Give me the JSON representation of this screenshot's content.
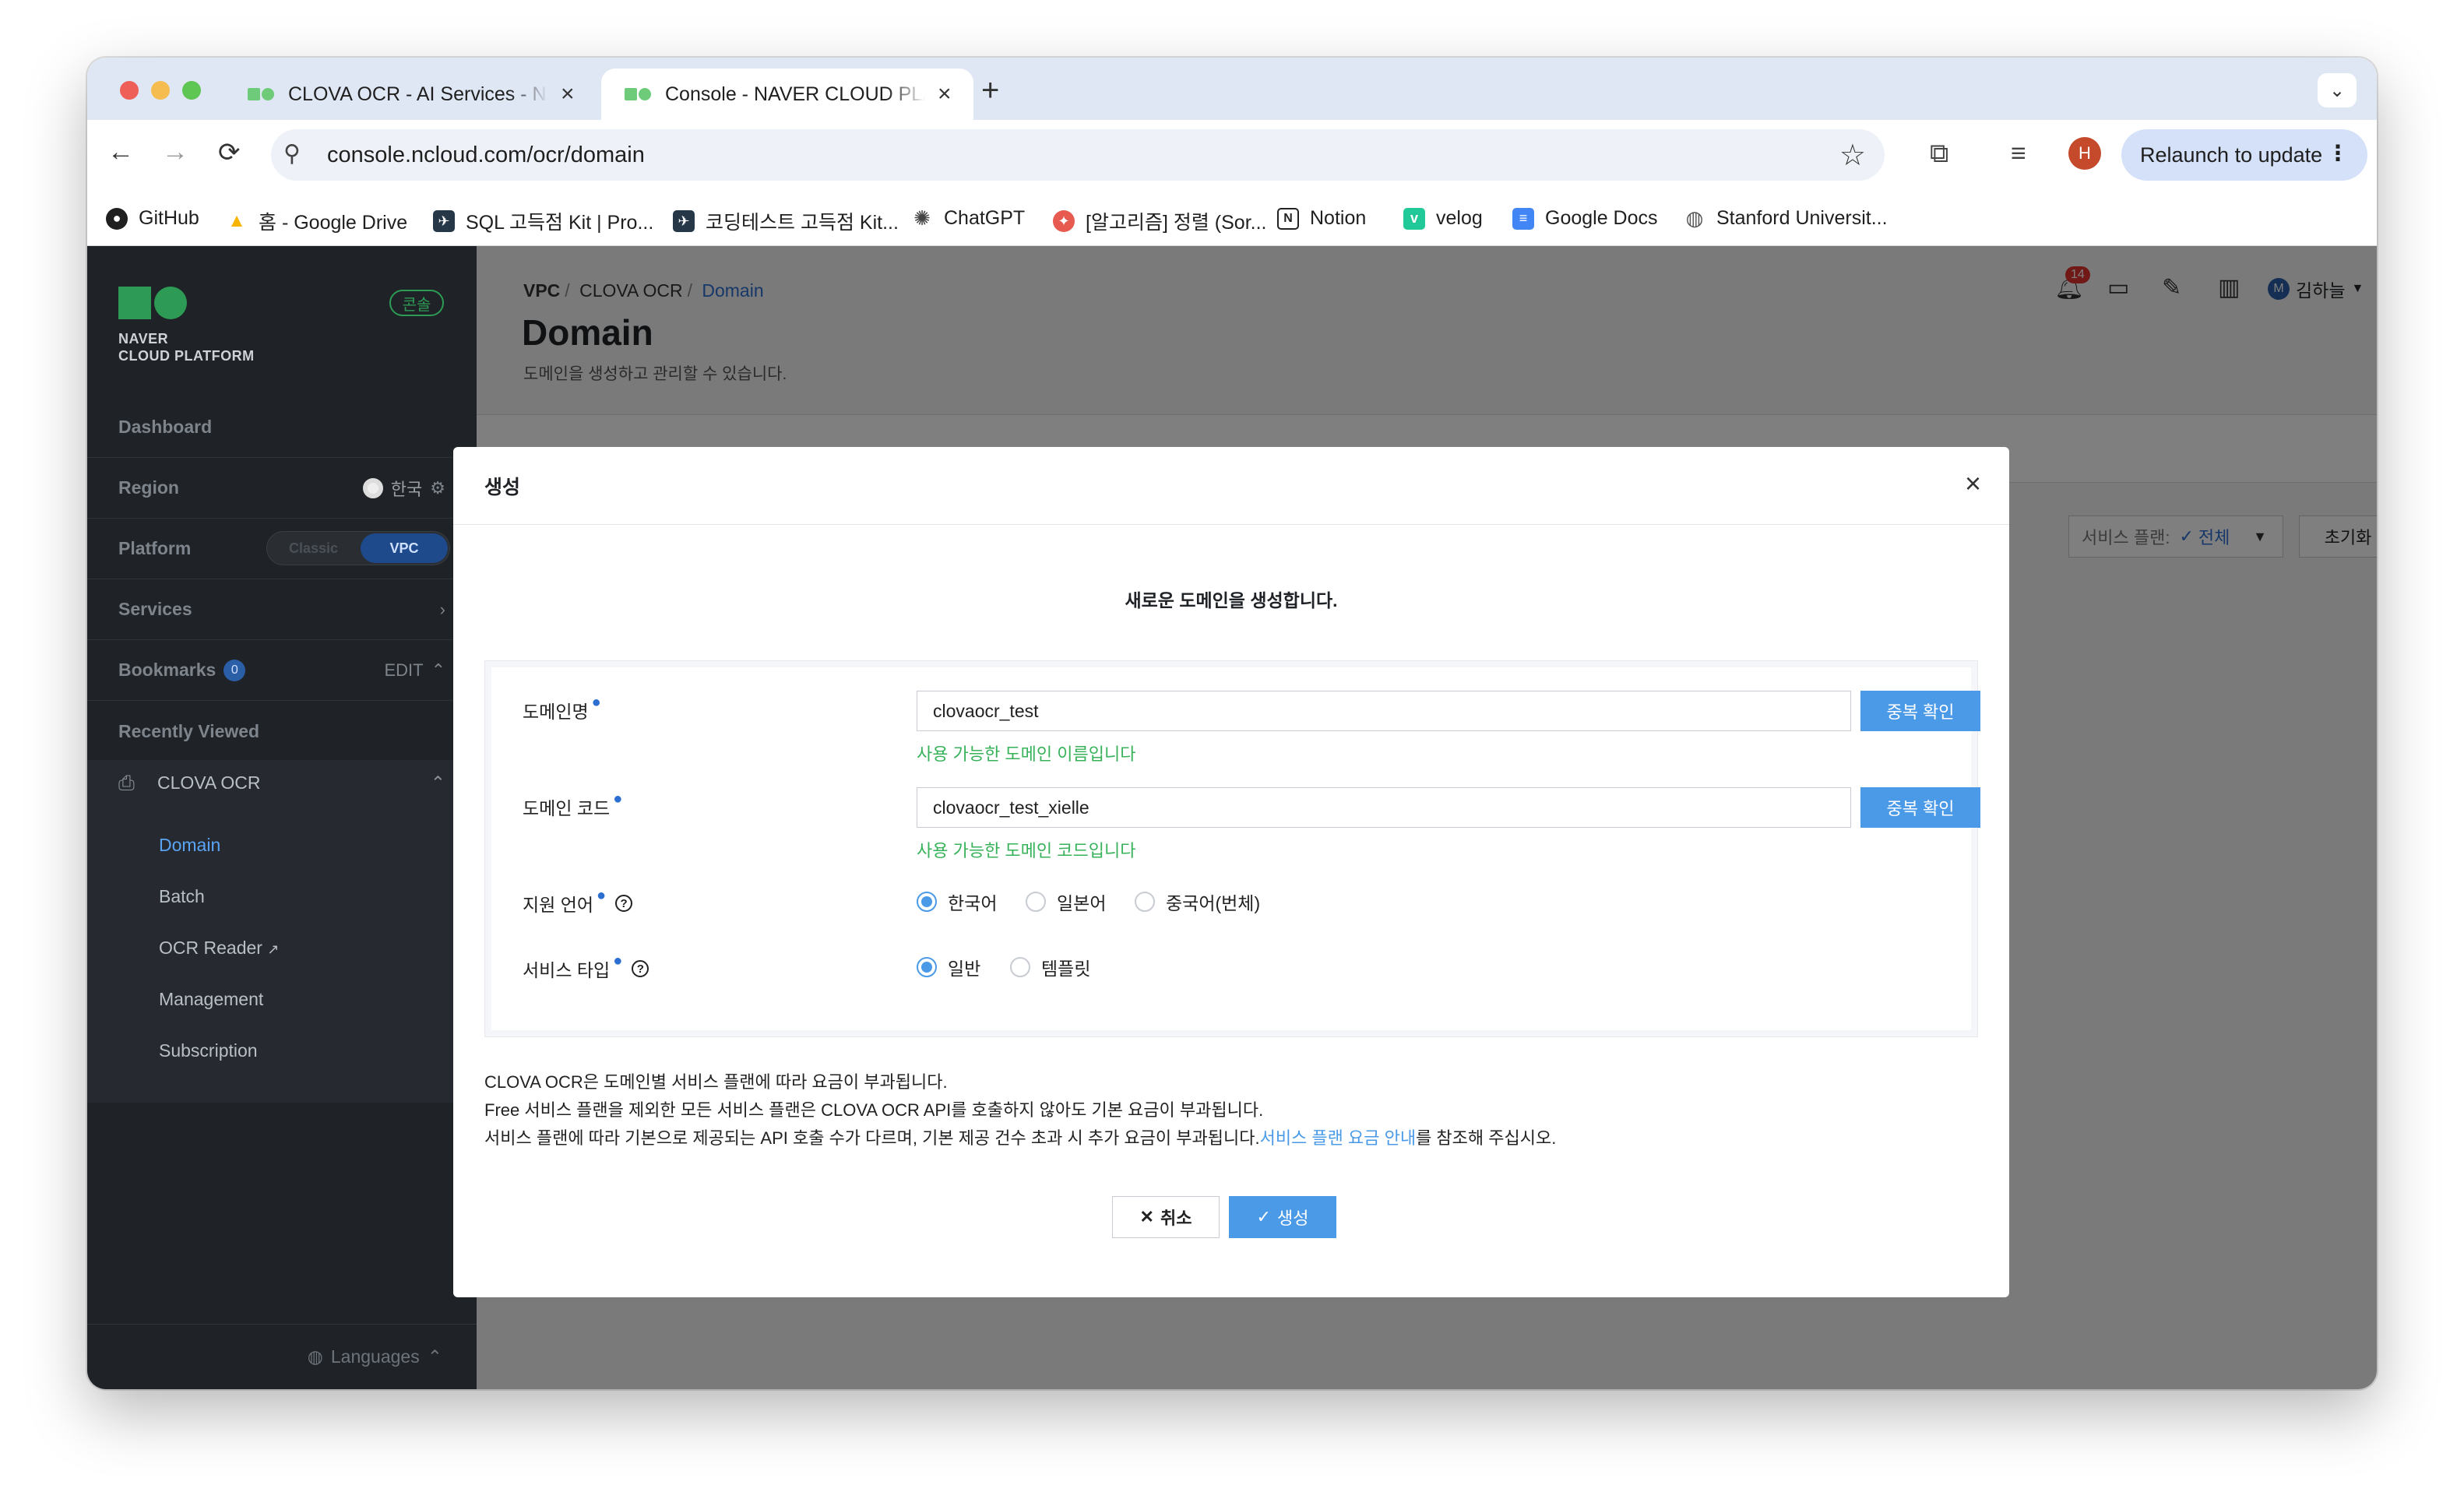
{
  "browser": {
    "tabs": [
      {
        "title": "CLOVA OCR - AI Services - N",
        "active": false
      },
      {
        "title": "Console - NAVER CLOUD PLA",
        "active": true
      }
    ],
    "url": "console.ncloud.com/ocr/domain",
    "profile_initial": "H",
    "relaunch_label": "Relaunch to update",
    "icons": {
      "back": "←",
      "forward": "→",
      "reload": "⟳",
      "star": "☆",
      "extensions": "⧉",
      "media": "≡",
      "tune": "⚲"
    }
  },
  "bookmarks": [
    {
      "label": "GitHub",
      "icon": "github-icon",
      "color": "#1f1f1f",
      "glyph": "●"
    },
    {
      "label": "홈 - Google Drive",
      "icon": "google-drive-icon",
      "color": "#f4b400",
      "glyph": "▲"
    },
    {
      "label": "SQL 고득점 Kit | Pro...",
      "icon": "programmers-icon",
      "color": "#263747",
      "glyph": "✈"
    },
    {
      "label": "코딩테스트 고득점 Kit...",
      "icon": "programmers-icon",
      "color": "#263747",
      "glyph": "✈"
    },
    {
      "label": "ChatGPT",
      "icon": "chatgpt-icon",
      "color": "#444444",
      "glyph": "✺"
    },
    {
      "label": "[알고리즘] 정렬 (Sor...",
      "icon": "blog-icon",
      "color": "#e65a4f",
      "glyph": "✦"
    },
    {
      "label": "Notion",
      "icon": "notion-icon",
      "color": "#222222",
      "glyph": "N"
    },
    {
      "label": "velog",
      "icon": "velog-icon",
      "color": "#20c997",
      "glyph": "v"
    },
    {
      "label": "Google Docs",
      "icon": "google-docs-icon",
      "color": "#4285f4",
      "glyph": "≡"
    },
    {
      "label": "Stanford Universit...",
      "icon": "globe-icon",
      "color": "#555555",
      "glyph": "◍"
    }
  ],
  "sidebar": {
    "logo_line1": "NAVER",
    "logo_line2": "CLOUD PLATFORM",
    "console_badge": "콘솔",
    "dashboard": "Dashboard",
    "region_label": "Region",
    "region_value": "한국",
    "platform_label": "Platform",
    "platform_classic": "Classic",
    "platform_vpc": "VPC",
    "services": "Services",
    "bookmarks_label": "Bookmarks",
    "bookmarks_count": "0",
    "bookmarks_edit": "EDIT",
    "recently_viewed": "Recently Viewed",
    "product": "CLOVA OCR",
    "sub_items": [
      "Domain",
      "Batch",
      "OCR Reader",
      "Management",
      "Subscription"
    ],
    "active_sub": "Domain",
    "languages": "Languages"
  },
  "content": {
    "breadcrumb": [
      "VPC",
      "CLOVA OCR",
      "Domain"
    ],
    "title": "Domain",
    "description": "도메인을 생성하고 관리할 수 있습니다.",
    "notification_count": "14",
    "user_initial": "M",
    "user_name": "김하늘",
    "filter_label": "서비스 플랜:",
    "filter_value": "전체",
    "reset_label": "초기화"
  },
  "modal": {
    "title": "생성",
    "subtitle": "새로운 도메인을 생성합니다.",
    "fields": {
      "domain_name_label": "도메인명",
      "domain_name_value": "clovaocr_test",
      "domain_name_ok": "사용 가능한 도메인 이름입니다",
      "domain_code_label": "도메인 코드",
      "domain_code_value": "clovaocr_test_xielle",
      "domain_code_ok": "사용 가능한 도메인 코드입니다",
      "dup_check": "중복 확인",
      "language_label": "지원 언어",
      "languages": [
        "한국어",
        "일본어",
        "중국어(번체)"
      ],
      "language_selected": "한국어",
      "service_type_label": "서비스 타입",
      "service_types": [
        "일반",
        "템플릿"
      ],
      "service_type_selected": "일반"
    },
    "notes": {
      "line1": "CLOVA OCR은 도메인별 서비스 플랜에 따라 요금이 부과됩니다.",
      "line2": "Free 서비스 플랜을 제외한 모든 서비스 플랜은 CLOVA OCR API를 호출하지 않아도 기본 요금이 부과됩니다.",
      "line3_prefix": "서비스 플랜에 따라 기본으로 제공되는 API 호출 수가 다르며, 기본 제공 건수 초과 시 추가 요금이 부과됩니다.",
      "line3_link": "서비스 플랜 요금 안내",
      "line3_suffix": "를 참조해 주십시오."
    },
    "cancel_label": "취소",
    "create_label": "생성"
  },
  "colors": {
    "accent_blue": "#4a9ae8",
    "success_green": "#37b25a",
    "brand_green": "#2d9b55",
    "sidebar_bg": "#1f2226"
  }
}
